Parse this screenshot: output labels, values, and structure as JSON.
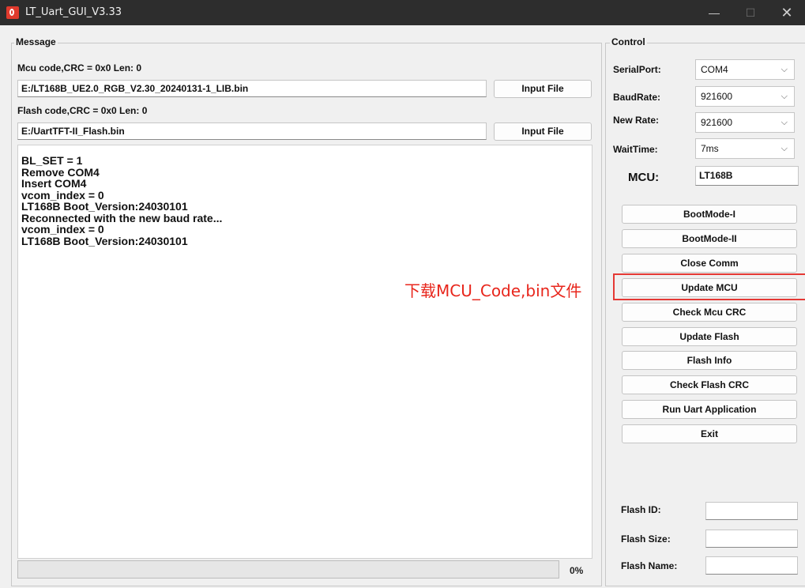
{
  "window": {
    "title": "LT_Uart_GUI_V3.33",
    "minimize": "—",
    "maximize": "☐",
    "close": "✕"
  },
  "message": {
    "group_label": "Message",
    "mcu_code_label": "Mcu code,CRC = 0x0  Len: 0",
    "mcu_file_path": "E:/LT168B_UE2.0_RGB_V2.30_20240131-1_LIB.bin",
    "flash_code_label": "Flash code,CRC = 0x0  Len: 0",
    "flash_file_path": "E:/UartTFT-II_Flash.bin",
    "input_file_label": "Input File",
    "log_lines": [
      "BL_SET = 1",
      "Remove COM4",
      "Insert COM4",
      "vcom_index = 0",
      "LT168B Boot_Version:24030101",
      "Reconnected with the new baud rate...",
      "vcom_index = 0",
      "LT168B Boot_Version:24030101"
    ],
    "progress_percent": 0,
    "progress_text": "0%"
  },
  "control": {
    "group_label": "Control",
    "serial_port_label": "SerialPort:",
    "serial_port_value": "COM4",
    "baud_rate_label": "BaudRate:",
    "baud_rate_value": "921600",
    "new_rate_label": "New Rate:",
    "new_rate_value": "921600",
    "wait_time_label": "WaitTime:",
    "wait_time_value": "7ms",
    "mcu_label": "MCU:",
    "mcu_value": "LT168B",
    "buttons": [
      "BootMode-I",
      "BootMode-II",
      "Close Comm",
      "Update MCU",
      "Check Mcu CRC",
      "Update Flash",
      "Flash Info",
      "Check Flash CRC",
      "Run Uart Application",
      "Exit"
    ],
    "flash_id_label": "Flash ID:",
    "flash_id_value": "",
    "flash_size_label": "Flash Size:",
    "flash_size_value": "",
    "flash_name_label": "Flash Name:",
    "flash_name_value": ""
  },
  "annotation": {
    "text": "下载MCU_Code,bin文件",
    "color": "#e8261c"
  }
}
